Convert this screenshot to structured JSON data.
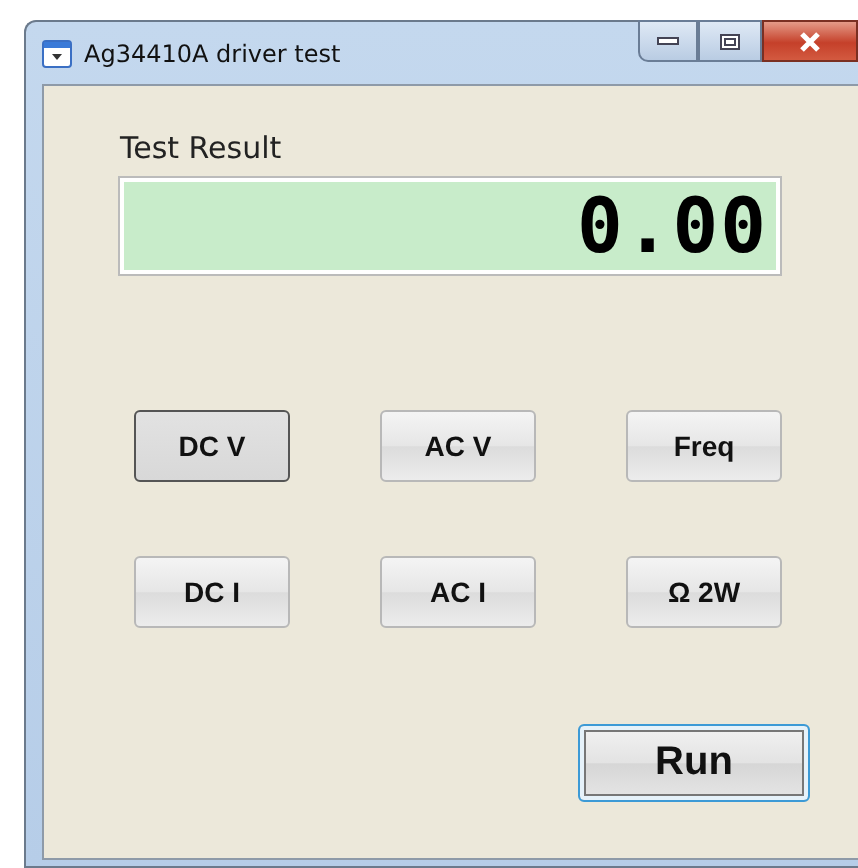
{
  "window": {
    "title": "Ag34410A driver test"
  },
  "result": {
    "label": "Test Result",
    "value": "0.00"
  },
  "modes": [
    {
      "label": "DC V",
      "selected": true
    },
    {
      "label": "AC V",
      "selected": false
    },
    {
      "label": "Freq",
      "selected": false
    },
    {
      "label": "DC I",
      "selected": false
    },
    {
      "label": "AC I",
      "selected": false
    },
    {
      "label": "Ω 2W",
      "selected": false
    }
  ],
  "run_button": {
    "label": "Run",
    "focused": true
  }
}
